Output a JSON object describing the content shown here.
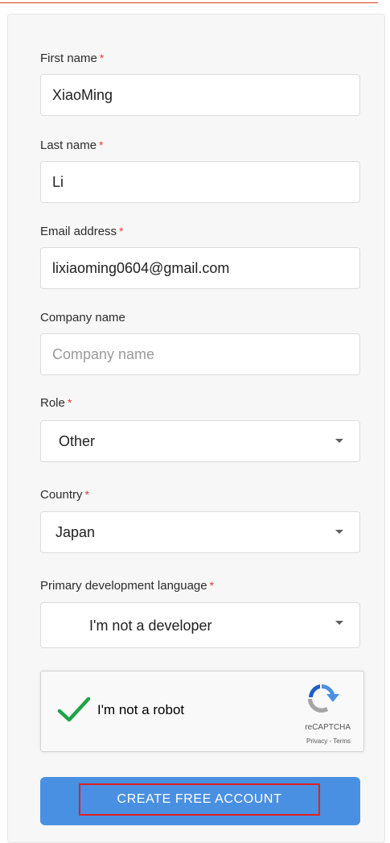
{
  "form": {
    "first_name": {
      "label": "First name",
      "required_mark": "*",
      "value": "XiaoMing"
    },
    "last_name": {
      "label": "Last name",
      "required_mark": "*",
      "value": "Li"
    },
    "email": {
      "label": "Email address",
      "required_mark": "*",
      "value": "lixiaoming0604@gmail.com"
    },
    "company": {
      "label": "Company name",
      "placeholder": "Company name"
    },
    "role": {
      "label": "Role",
      "required_mark": "*",
      "selected": "Other"
    },
    "country": {
      "label": "Country",
      "required_mark": "*",
      "selected": "Japan"
    },
    "language": {
      "label": "Primary development language",
      "required_mark": "*",
      "selected": "I'm not a developer"
    }
  },
  "recaptcha": {
    "label": "I'm not a robot",
    "brand": "reCAPTCHA",
    "privacy": "Privacy",
    "separator": " - ",
    "terms": "Terms",
    "checked": true,
    "check_color": "#1fa346"
  },
  "submit": {
    "label": "CREATE FREE ACCOUNT",
    "color": "#4a90e2"
  },
  "colors": {
    "required": "#e53935",
    "highlight_box": "#e02020"
  }
}
